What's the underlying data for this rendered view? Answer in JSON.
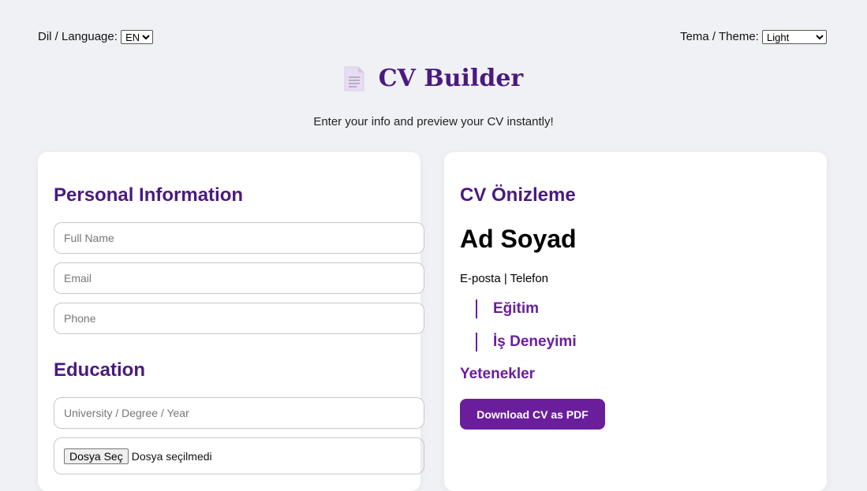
{
  "topbar": {
    "language_label": "Dil / Language:",
    "language_value": "EN",
    "theme_label": "Tema / Theme:",
    "theme_value": "Light"
  },
  "header": {
    "title": "CV Builder",
    "icon": "document-icon",
    "subtitle": "Enter your info and preview your CV instantly!"
  },
  "form": {
    "personal_title": "Personal Information",
    "full_name_placeholder": "Full Name",
    "email_placeholder": "Email",
    "phone_placeholder": "Phone",
    "education_title": "Education",
    "education_placeholder": "University / Degree / Year",
    "file_button_label": "Dosya Seç",
    "file_status": "Dosya seçilmedi"
  },
  "preview": {
    "title": "CV Önizleme",
    "name": "Ad Soyad",
    "contact": "E-posta | Telefon",
    "education_heading": "Eğitim",
    "experience_heading": "İş Deneyimi",
    "skills_heading": "Yetenekler",
    "download_button": "Download CV as PDF"
  },
  "colors": {
    "accent": "#4a1a7e",
    "button": "#6a1e9c",
    "background": "#f0f1f5"
  }
}
